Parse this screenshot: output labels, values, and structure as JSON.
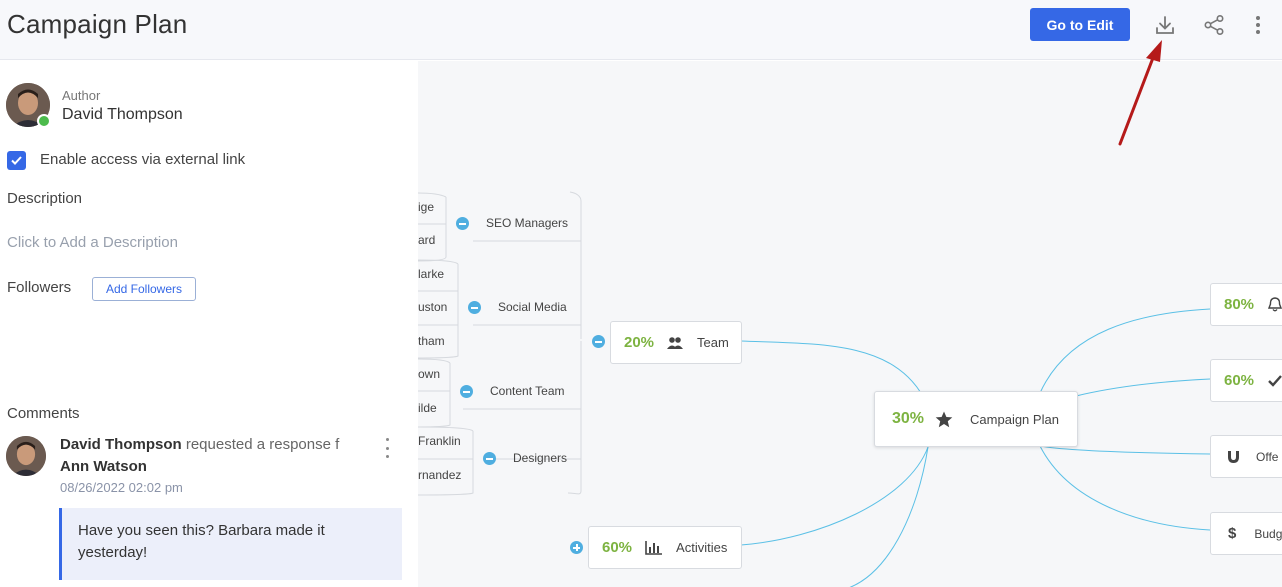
{
  "header": {
    "title": "Campaign Plan",
    "edit_label": "Go to Edit"
  },
  "sidebar": {
    "author_label": "Author",
    "author_name": "David Thompson",
    "external_link_label": "Enable access via external link",
    "description_label": "Description",
    "description_placeholder": "Click to Add a Description",
    "followers_label": "Followers",
    "add_followers_label": "Add Followers",
    "comments_label": "Comments",
    "comment": {
      "author": "David Thompson",
      "action": "requested a response f",
      "target": "Ann Watson",
      "date": "08/26/2022 02:02 pm",
      "text": "Have you seen this? Barbara made it yesterday!"
    }
  },
  "mindmap": {
    "root": {
      "pct": "30%",
      "label": "Campaign Plan"
    },
    "team": {
      "pct": "20%",
      "label": "Team"
    },
    "activities": {
      "pct": "60%",
      "label": "Activities"
    },
    "groups": {
      "seo": "SEO Managers",
      "social": "Social Media",
      "content": "Content Team",
      "designers": "Designers"
    },
    "leaves": [
      "ige",
      "ard",
      "larke",
      "uston",
      "tham",
      "own",
      "ilde",
      "Franklin",
      "rnandez"
    ],
    "right_nodes": [
      {
        "pct": "80%",
        "icon": "bell-icon"
      },
      {
        "pct": "60%",
        "icon": "check-icon"
      },
      {
        "label": "Offe",
        "icon": "magnet-icon"
      },
      {
        "label": "Budg",
        "icon": "dollar-icon"
      }
    ]
  },
  "colors": {
    "accent": "#3568e6",
    "percent": "#7db341",
    "connector": "#5bc0e6",
    "online": "#4cbb4c",
    "arrow": "#b51a1a"
  }
}
